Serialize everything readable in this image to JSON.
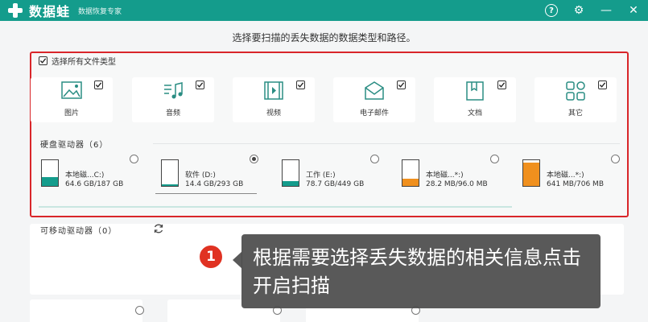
{
  "app": {
    "name": "数据蛙",
    "subtitle": "数据恢复专家",
    "help_glyph": "?",
    "settings_glyph": "⚙",
    "minimize_glyph": "—",
    "close_glyph": "✕"
  },
  "heading": "选择要扫描的丢失数据的数据类型和路径。",
  "select_all": {
    "label": "选择所有文件类型",
    "checked": true
  },
  "file_types": [
    {
      "label": "图片",
      "icon": "image-icon",
      "checked": true
    },
    {
      "label": "音频",
      "icon": "audio-icon",
      "checked": true
    },
    {
      "label": "视频",
      "icon": "video-icon",
      "checked": true
    },
    {
      "label": "电子邮件",
      "icon": "email-icon",
      "checked": true
    },
    {
      "label": "文档",
      "icon": "document-icon",
      "checked": true
    },
    {
      "label": "其它",
      "icon": "other-icon",
      "checked": true
    }
  ],
  "drives_section": {
    "title": "硬盘驱动器（6）"
  },
  "drives": [
    {
      "name": "本地磁...C:)",
      "size": "64.6 GB/187 GB",
      "used_fraction": 0.35,
      "fill_color": "#149c8c",
      "selected": false
    },
    {
      "name": "软件 (D:)",
      "size": "14.4 GB/293 GB",
      "used_fraction": 0.05,
      "fill_color": "#149c8c",
      "selected": true
    },
    {
      "name": "工作 (E:)",
      "size": "78.7 GB/449 GB",
      "used_fraction": 0.18,
      "fill_color": "#149c8c",
      "selected": false
    },
    {
      "name": "本地磁...*:)",
      "size": "28.2 MB/96.0 MB",
      "used_fraction": 0.29,
      "fill_color": "#f0901e",
      "selected": false
    },
    {
      "name": "本地磁...*:)",
      "size": "641 MB/706 MB",
      "used_fraction": 0.91,
      "fill_color": "#f0901e",
      "selected": false
    }
  ],
  "removable_section": {
    "title": "可移动驱动器（0）"
  },
  "tooltip": {
    "badge": "1",
    "text": "根据需要选择丢失数据的相关信息点击开启扫描"
  },
  "colors": {
    "accent": "#149c8c",
    "highlight": "#d9262a",
    "warning": "#f0901e"
  }
}
